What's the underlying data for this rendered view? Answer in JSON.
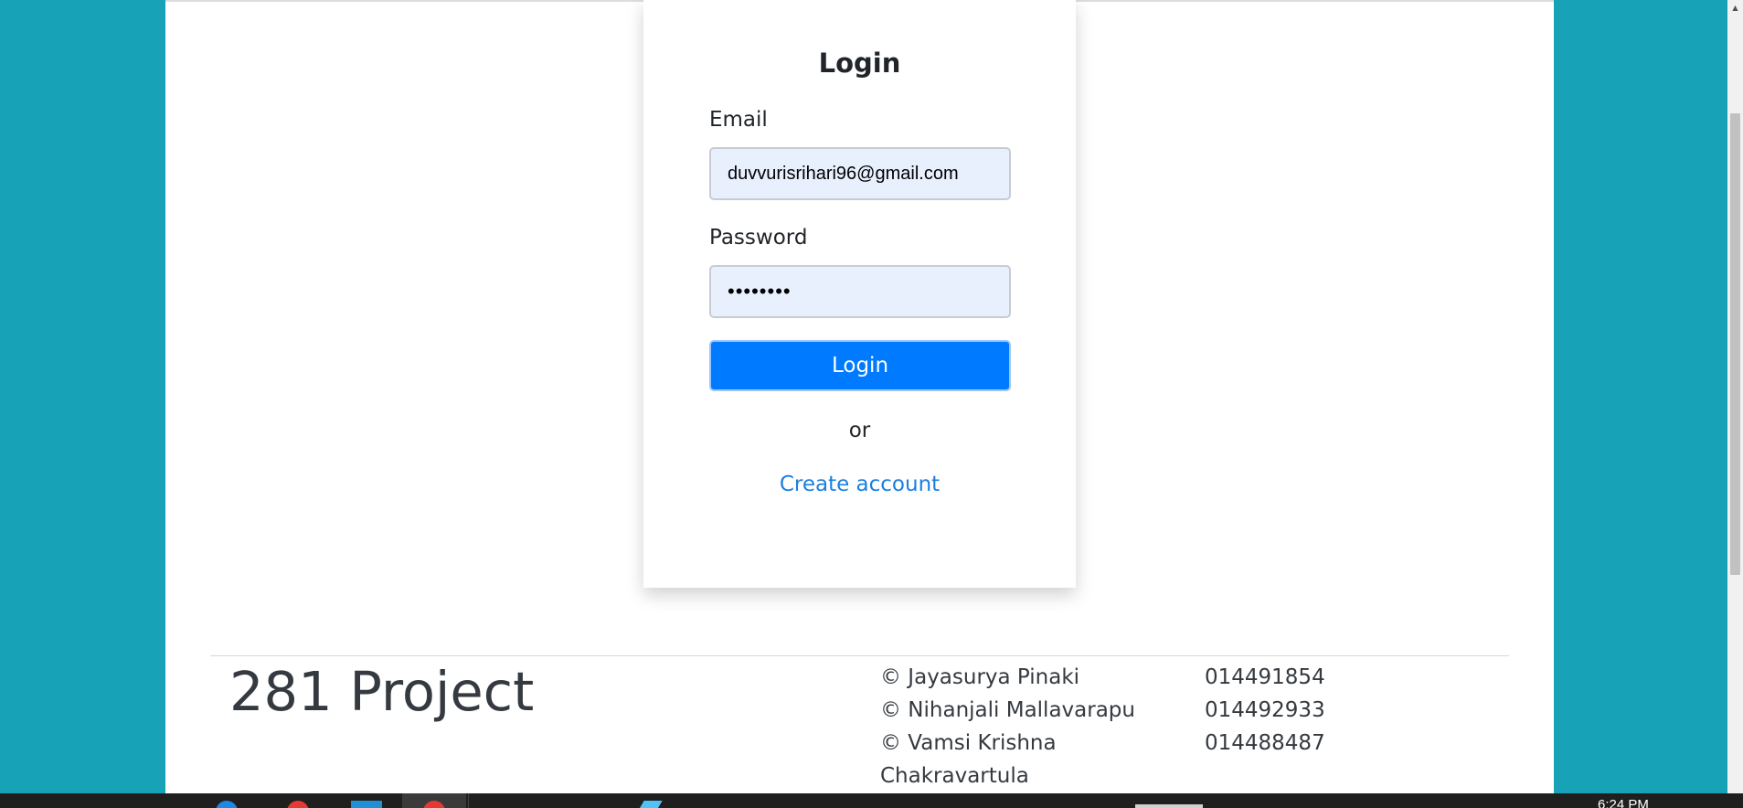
{
  "colors": {
    "page_background": "#17a2b8",
    "primary_button": "#007bff",
    "link": "#1a7fe0",
    "input_autofill": "#e8f0fe"
  },
  "login": {
    "title": "Login",
    "email_label": "Email",
    "email_value": "duvvurisrihari96@gmail.com",
    "password_label": "Password",
    "password_value": "••••••••",
    "submit_label": "Login",
    "or_text": "or",
    "create_account_label": "Create account"
  },
  "footer": {
    "brand": "281 Project",
    "credits": [
      {
        "name": "© Jayasurya Pinaki",
        "id": "014491854"
      },
      {
        "name": "© Nihanjali Mallavarapu",
        "id": "014492933"
      },
      {
        "name": "© Vamsi Krishna",
        "id": "014488487"
      },
      {
        "name": "Chakravartula",
        "id": ""
      }
    ]
  },
  "taskbar": {
    "clock": "6:24 PM"
  },
  "icons": {
    "scroll_up": "chevron-up-icon"
  }
}
